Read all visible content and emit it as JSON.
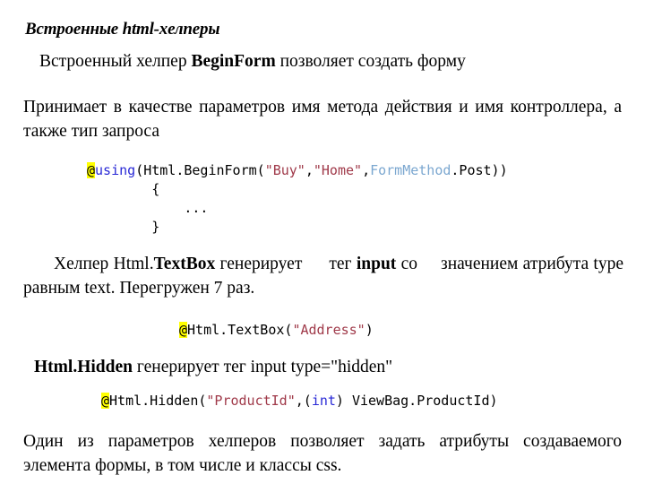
{
  "slide": {
    "title": "Встроенные html-хелперы",
    "paragraphs": {
      "beginform": {
        "pre": "Встроенный хелпер ",
        "bold": "BeginForm",
        "post": " позволяет создать форму"
      },
      "params": "Принимает в качестве параметров имя метода действия и имя контроллера, а также тип запроса",
      "textbox": {
        "p1": "Хелпер Html.",
        "b1": "TextBox",
        "p2": " генерирует",
        "p3": "тег ",
        "b2": "input",
        "p4": " со",
        "p5": "значением атрибута type равным text. Перегружен 7 раз."
      },
      "hidden": {
        "bold": "Html.Hidden",
        "post": " генерирует тег input type=\"hidden\""
      },
      "attrs": "Один из параметров хелперов позволяет задать атрибуты создаваемого элемента формы, в том числе и классы css."
    },
    "code_blocks": {
      "beginform": {
        "at": "@",
        "keyword": "using",
        "open": "(Html.BeginForm(",
        "str_buy": "\"Buy\"",
        "comma1": ",",
        "str_home": "\"Home\"",
        "comma2": ",",
        "type": "FormMethod",
        "tail": ".Post))",
        "line_open_brace": "        {",
        "line_ellipsis": "            ...",
        "line_close_brace": "        }"
      },
      "textbox": {
        "at": "@",
        "pre": "Html.TextBox(",
        "str": "\"Address\"",
        "post": ")"
      },
      "hidden": {
        "at": "@",
        "pre": "Html.Hidden(",
        "str": "\"ProductId\"",
        "mid": ",(",
        "keyword": "int",
        "post": ") ViewBag.ProductId)"
      }
    },
    "colors": {
      "highlight": "#ffff00",
      "keyword": "#2929d6",
      "string": "#a03a4a",
      "type": "#7ba7d0",
      "text": "#000000",
      "background": "#ffffff"
    }
  }
}
